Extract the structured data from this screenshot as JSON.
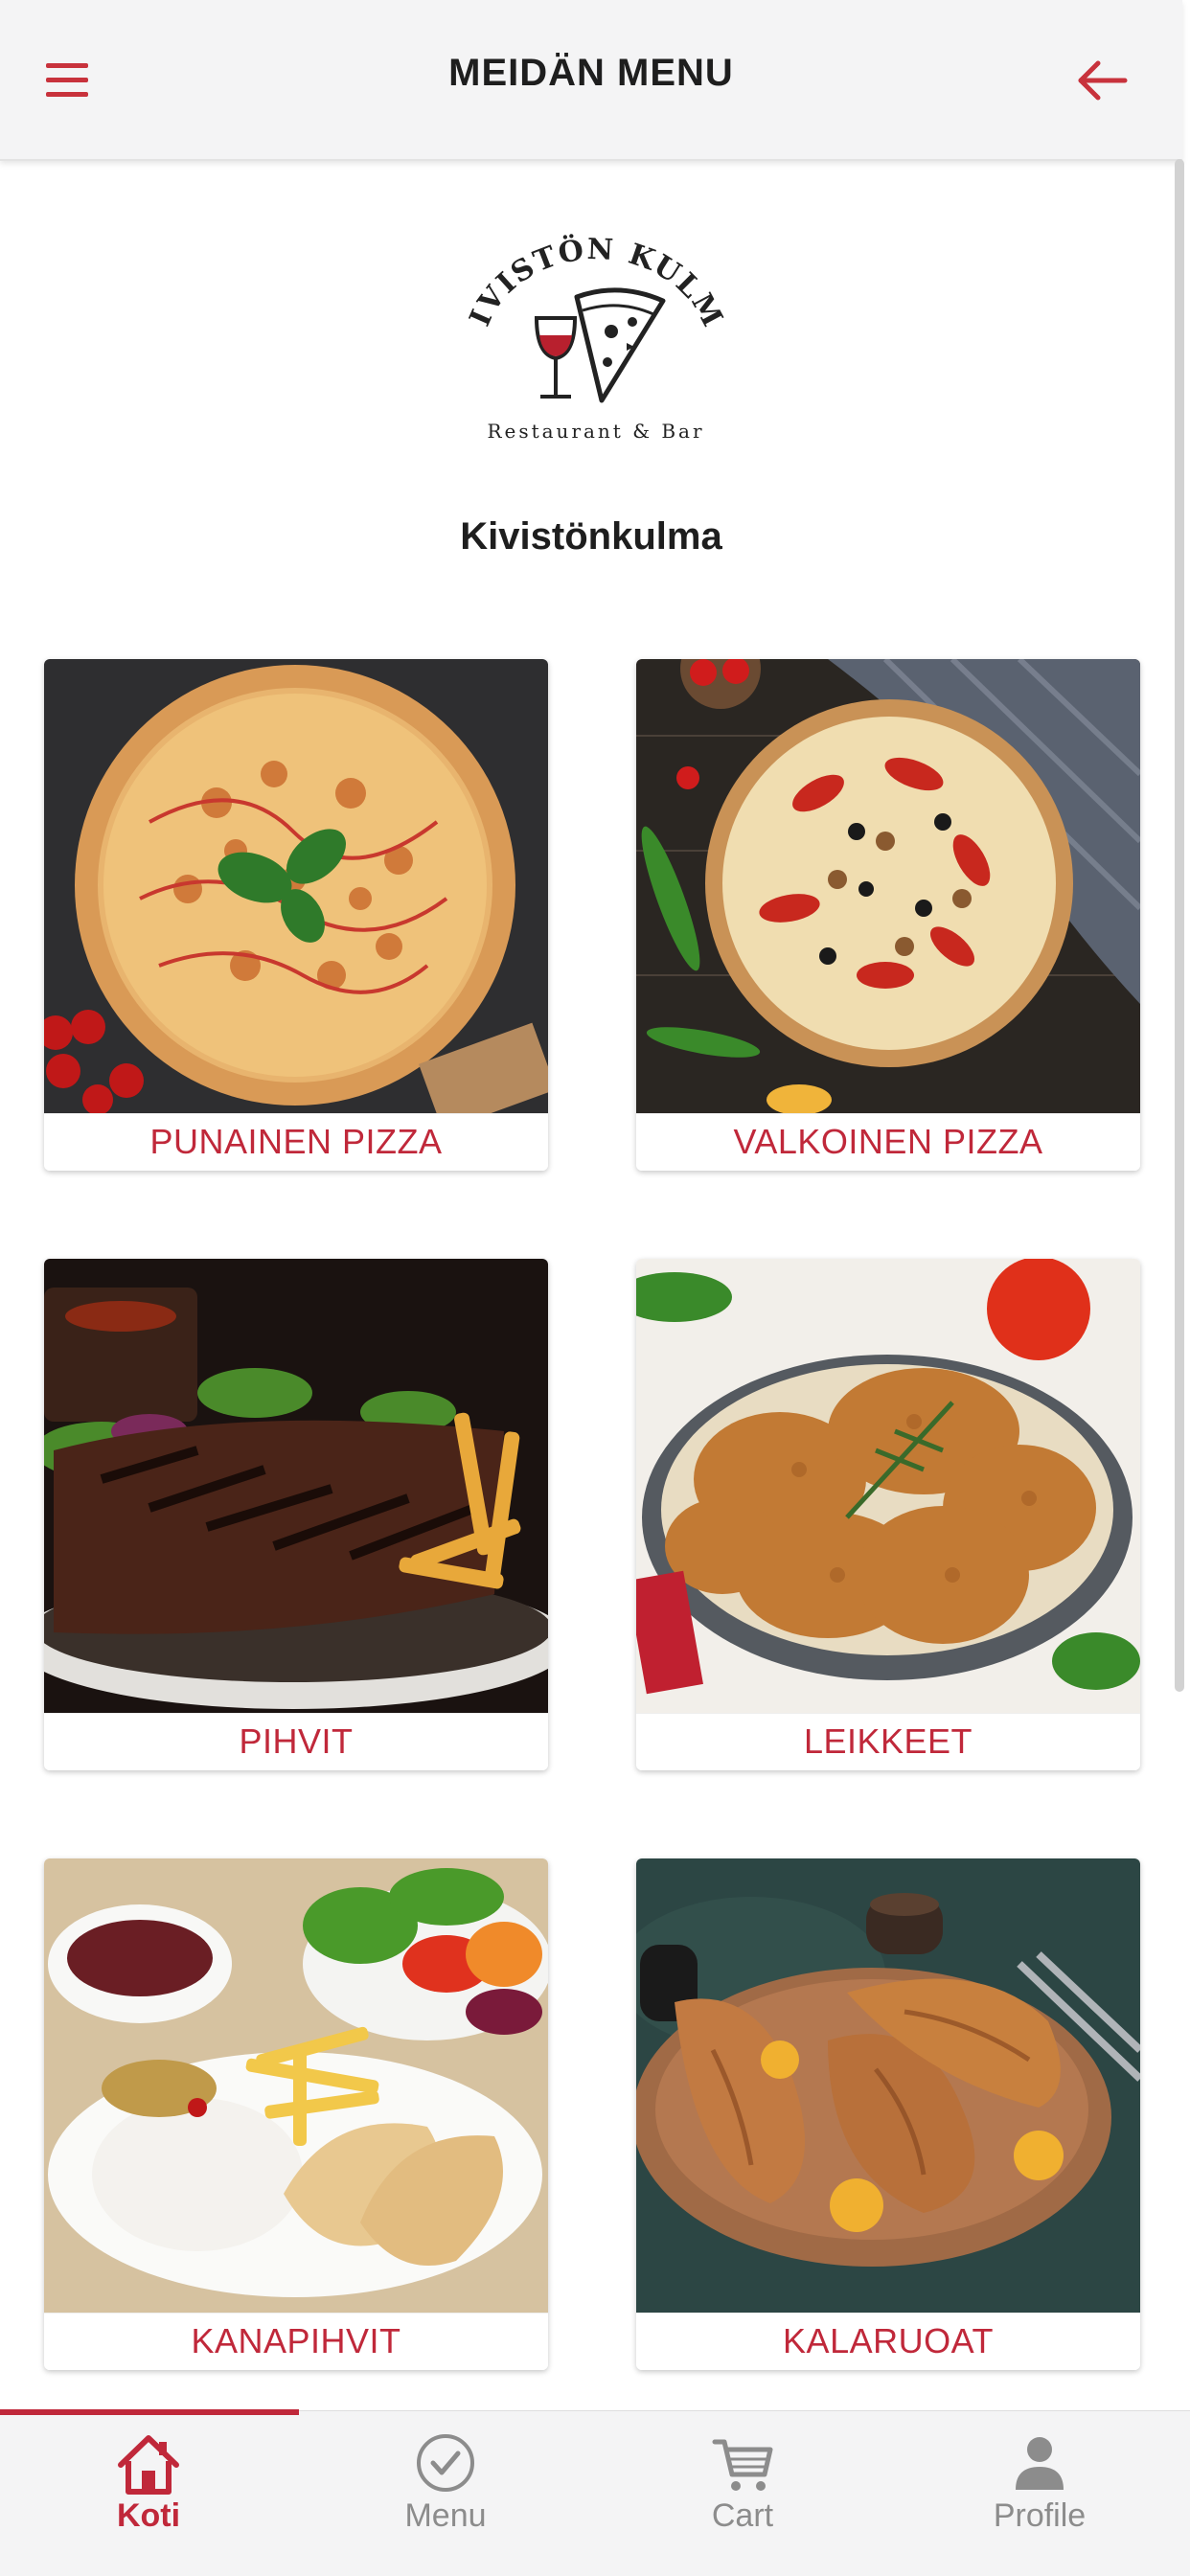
{
  "header": {
    "title": "MEIDÄN MENU",
    "menu_icon": "hamburger-menu-icon",
    "back_icon": "arrow-left-icon",
    "accent_color": "#c0283a"
  },
  "logo": {
    "arc_text": "KIVISTÖN KULMA",
    "subtitle": "Restaurant & Bar",
    "icon": "wine-glass-pizza-slice-logo"
  },
  "restaurant_name": "Kivistönkulma",
  "categories": [
    {
      "label": "PUNAINEN PIZZA",
      "image": "red-pizza-photo"
    },
    {
      "label": "VALKOINEN PIZZA",
      "image": "white-pizza-photo"
    },
    {
      "label": "PIHVIT",
      "image": "grilled-steak-photo"
    },
    {
      "label": "LEIKKEET",
      "image": "breaded-cutlets-photo"
    },
    {
      "label": "KANAPIHVIT",
      "image": "chicken-fillet-plate-photo"
    },
    {
      "label": "KALARUOAT",
      "image": "fried-fish-photo"
    }
  ],
  "bottom_nav": {
    "active": "Koti",
    "items": [
      {
        "label": "Koti",
        "icon": "home-icon"
      },
      {
        "label": "Menu",
        "icon": "check-circle-icon"
      },
      {
        "label": "Cart",
        "icon": "cart-icon"
      },
      {
        "label": "Profile",
        "icon": "person-icon"
      }
    ]
  }
}
